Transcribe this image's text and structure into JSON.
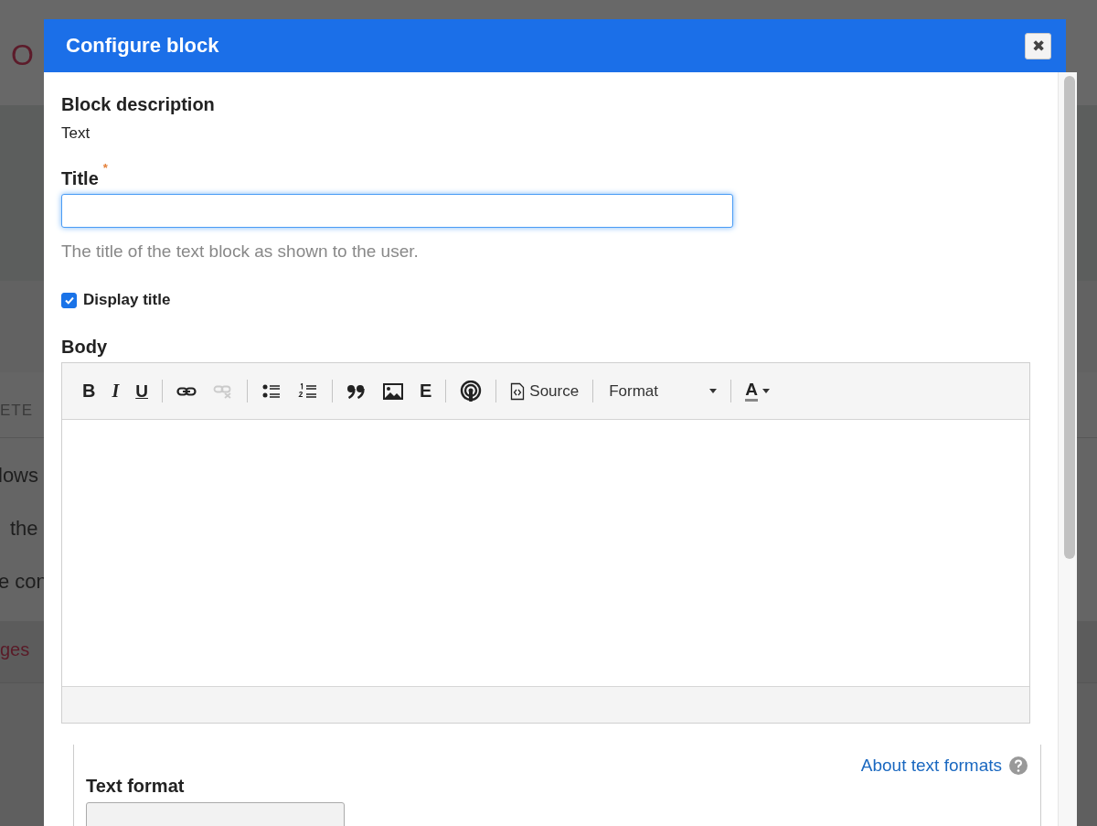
{
  "background_page": {
    "logo_fragment": "O",
    "column_fragment": "ETE",
    "text_fragments": [
      "lows",
      "the",
      "e con"
    ],
    "link_fragment": "ges"
  },
  "dialog": {
    "title": "Configure block",
    "close": "✖",
    "block_description": {
      "label": "Block description",
      "value": "Text"
    },
    "title_field": {
      "label": "Title",
      "required_mark": "*",
      "required": true,
      "focused": true,
      "description": "The title of the text block as shown to the user."
    },
    "display_title": {
      "label": "Display title",
      "checked": true
    },
    "body": {
      "label": "Body",
      "toolbar": [
        [
          {
            "kind": "bold",
            "label": "B",
            "disabled": false
          },
          {
            "kind": "italic",
            "label": "I",
            "disabled": false
          },
          {
            "kind": "underline",
            "label": "U",
            "disabled": false
          }
        ],
        [
          {
            "kind": "link",
            "disabled": false
          },
          {
            "kind": "unlink",
            "disabled": true
          }
        ],
        [
          {
            "kind": "bullets",
            "disabled": false
          },
          {
            "kind": "numbers",
            "disabled": false
          }
        ],
        [
          {
            "kind": "quote",
            "disabled": false
          },
          {
            "kind": "image",
            "disabled": false
          },
          {
            "kind": "letter",
            "label": "E",
            "disabled": false
          }
        ],
        [
          {
            "kind": "media",
            "disabled": false
          }
        ],
        [
          {
            "kind": "source",
            "label": "Source",
            "disabled": false
          }
        ],
        [
          {
            "kind": "format",
            "label": "Format",
            "disabled": false
          }
        ],
        [
          {
            "kind": "color",
            "label": "A",
            "disabled": false
          }
        ]
      ]
    },
    "text_format": {
      "label": "Text format",
      "help_link": "About text formats"
    }
  }
}
